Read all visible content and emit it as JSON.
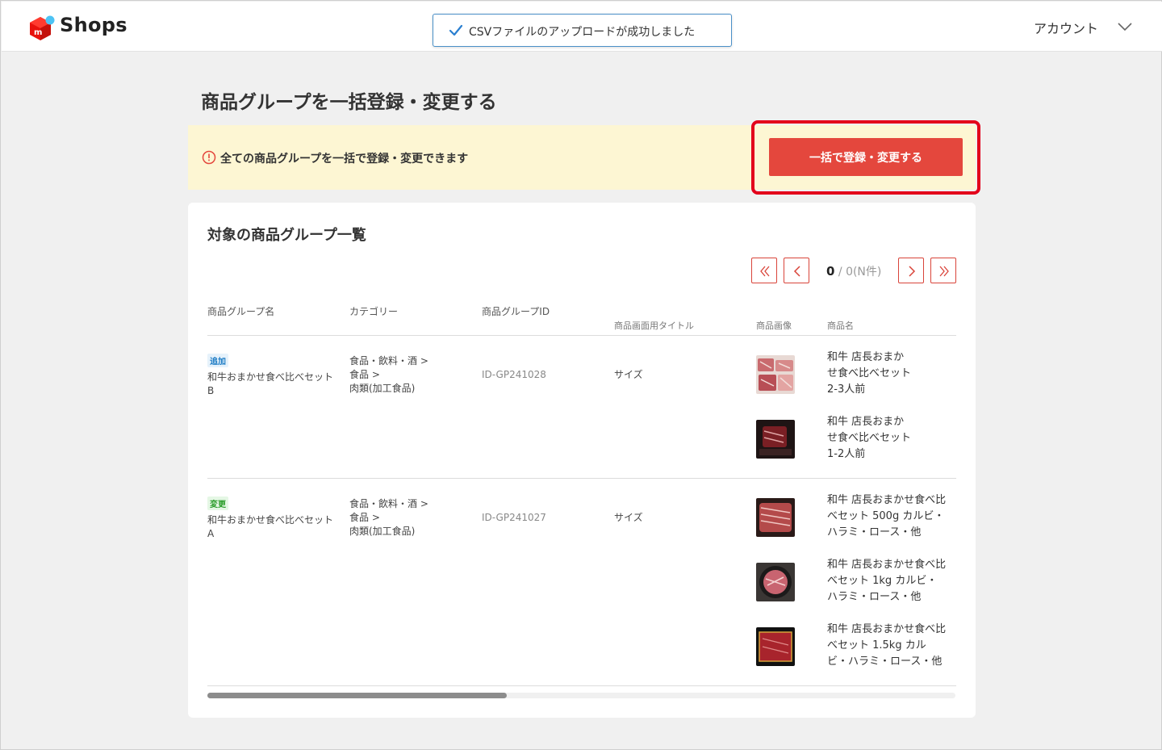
{
  "header": {
    "logo_text": "Shops",
    "toast_text": "CSVファイルのアップロードが成功しました",
    "account_label": "アカウント"
  },
  "page": {
    "title": "商品グループを一括登録・変更する"
  },
  "notice": {
    "text": "全ての商品グループを一括で登録・変更できます",
    "button_label": "一括で登録・変更する"
  },
  "list": {
    "title": "対象の商品グループ一覧",
    "pager": {
      "current": "0",
      "separator": " / ",
      "total": "0(N件)"
    },
    "columns": {
      "group_name": "商品グループ名",
      "category": "カテゴリー",
      "group_id": "商品グループID",
      "screen_title": "商品画面用タイトル",
      "image": "商品画像",
      "product_name": "商品名"
    },
    "rows": [
      {
        "badge": "追加",
        "name_line1": "和牛おまかせ食べ比べセット",
        "name_line2": "B",
        "category_line1": "食品・飲料・酒 >",
        "category_line2": "食品 >",
        "category_line3": "肉類(加工食品)",
        "id": "ID-GP241028",
        "screen_title": "サイズ",
        "products": [
          {
            "line1": "和牛 店長おまか",
            "line2": "せ食べ比べセット",
            "line3": "2-3人前"
          },
          {
            "line1": "和牛 店長おまか",
            "line2": "せ食べ比べセット",
            "line3": "1-2人前"
          }
        ]
      },
      {
        "badge": "変更",
        "name_line1": "和牛おまかせ食べ比べセット",
        "name_line2": "A",
        "category_line1": "食品・飲料・酒 >",
        "category_line2": "食品 >",
        "category_line3": "肉類(加工食品)",
        "id": "ID-GP241027",
        "screen_title": "サイズ",
        "products": [
          {
            "line1": "和牛 店長おまかせ食べ比",
            "line2": "べセット 500g カルビ・",
            "line3": "ハラミ・ロース・他"
          },
          {
            "line1": "和牛 店長おまかせ食べ比",
            "line2": "べセット 1kg カルビ・",
            "line3": "ハラミ・ロース・他"
          },
          {
            "line1": "和牛 店長おまかせ食べ比",
            "line2": "べセット 1.5kg カル",
            "line3": "ビ・ハラミ・ロース・他"
          }
        ]
      }
    ]
  },
  "colors": {
    "brand_red": "#e4473d",
    "notice_bg": "#fdf6d3",
    "highlight": "#e3001b",
    "toast_border": "#4a90c8"
  },
  "icons": {
    "logo": "mercari-shops-logo",
    "toast": "check-icon",
    "account": "chevron-down-icon",
    "notice": "info-circle-icon",
    "pager_first": "double-chevron-left-icon",
    "pager_prev": "chevron-left-icon",
    "pager_next": "chevron-right-icon",
    "pager_last": "double-chevron-right-icon"
  },
  "scroll": {
    "horizontal_position_fraction": 0.0,
    "visible_fraction": 0.4
  }
}
